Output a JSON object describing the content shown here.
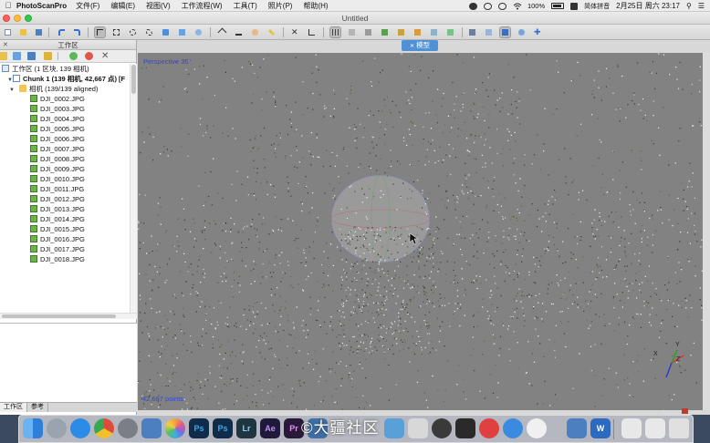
{
  "menubar": {
    "app_name": "PhotoScanPro",
    "menus": [
      "文件(F)",
      "编辑(E)",
      "视图(V)",
      "工作流程(W)",
      "工具(T)",
      "照片(P)",
      "帮助(H)"
    ],
    "battery": "100%",
    "input_method": "简体拼音",
    "datetime": "2月25日 周六  23:17"
  },
  "window": {
    "title": "Untitled"
  },
  "workspace": {
    "panel_title": "工作区",
    "root_label": "工作区 (1 区块, 139 相机)",
    "chunk_label": "Chunk 1 (139 相机, 42,667 点) [F",
    "cameras_label": "相机 (139/139 aligned)",
    "images": [
      "DJI_0002.JPG",
      "DJI_0003.JPG",
      "DJI_0004.JPG",
      "DJI_0005.JPG",
      "DJI_0006.JPG",
      "DJI_0007.JPG",
      "DJI_0008.JPG",
      "DJI_0009.JPG",
      "DJI_0010.JPG",
      "DJI_0011.JPG",
      "DJI_0012.JPG",
      "DJI_0013.JPG",
      "DJI_0014.JPG",
      "DJI_0015.JPG",
      "DJI_0016.JPG",
      "DJI_0017.JPG",
      "DJI_0018.JPG"
    ],
    "bottom_tabs": [
      "工作区",
      "参考"
    ]
  },
  "viewport": {
    "tab_label": "模型",
    "projection_label": "Perspective 30°",
    "points_label": "42,667 points",
    "axis_labels": [
      "X",
      "Y",
      "Z"
    ],
    "background_color": "#828282"
  },
  "dock": {
    "watermark": "©大疆社区",
    "apps": [
      "Finder",
      "Launchpad",
      "Safari",
      "Chrome",
      "System Preferences",
      "Preview",
      "Photos",
      "Ps",
      "Ps",
      "Lr",
      "Ae",
      "Pr",
      "QQ",
      "Word",
      "Trash"
    ]
  }
}
